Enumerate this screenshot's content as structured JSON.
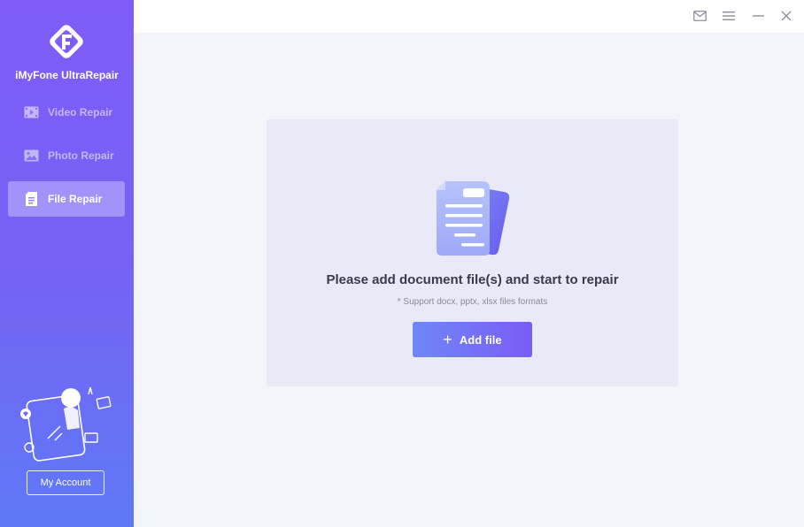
{
  "app": {
    "name": "iMyFone UltraRepair"
  },
  "sidebar": {
    "items": [
      {
        "label": "Video Repair",
        "icon": "video-icon",
        "active": false
      },
      {
        "label": "Photo Repair",
        "icon": "photo-icon",
        "active": false
      },
      {
        "label": "File Repair",
        "icon": "file-icon",
        "active": true
      }
    ],
    "account_label": "My Account"
  },
  "window_controls": {
    "icons": [
      "mail-icon",
      "menu-icon",
      "minimize-icon",
      "close-icon"
    ]
  },
  "main": {
    "prompt": "Please add document file(s) and start to repair",
    "formats_note": "* Support docx, pptx, xlsx files formats",
    "add_button_label": "Add file",
    "add_button_icon": "plus-icon"
  },
  "colors": {
    "accent": "#7a5cf5",
    "sidebar_top": "#7f5cf6",
    "sidebar_bottom": "#5f79f6",
    "panel_bg": "#e9e9f8",
    "app_bg": "#f4f4fb"
  }
}
